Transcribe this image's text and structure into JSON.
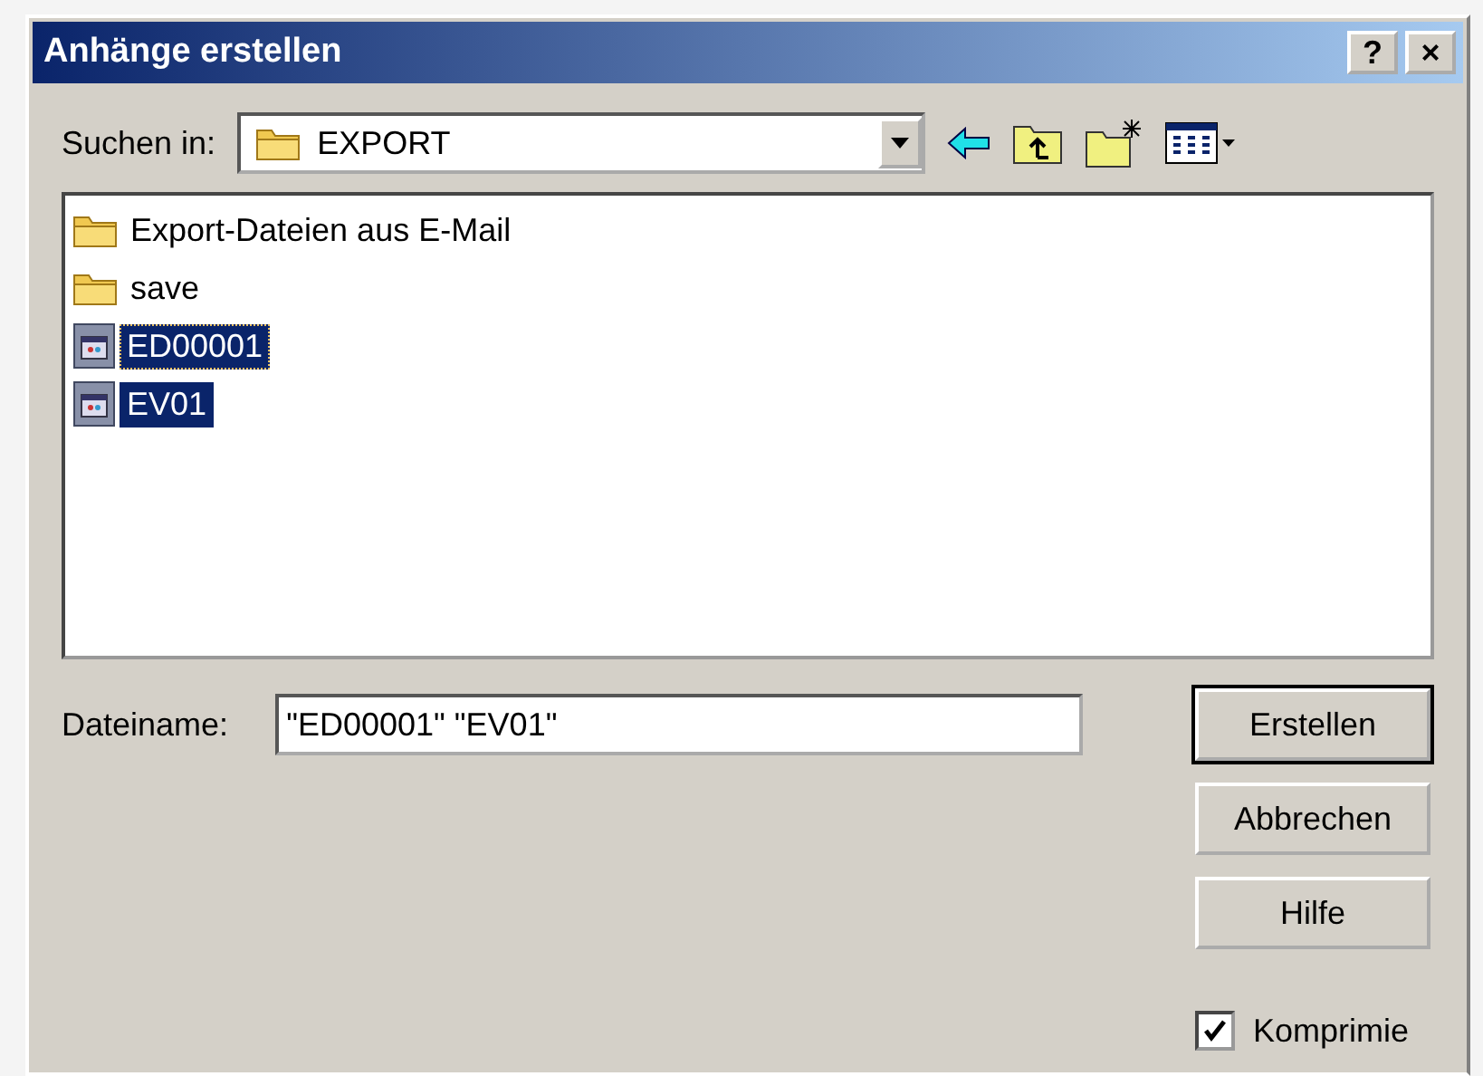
{
  "window": {
    "title": "Anhänge erstellen",
    "help_button": "?",
    "close_button": "×"
  },
  "look_in": {
    "label": "Suchen in:",
    "value": "EXPORT"
  },
  "files": [
    {
      "name": "Export-Dateien aus E-Mail",
      "kind": "folder",
      "selected": false,
      "focused": false
    },
    {
      "name": "save",
      "kind": "folder",
      "selected": false,
      "focused": false
    },
    {
      "name": "ED00001",
      "kind": "file",
      "selected": true,
      "focused": true
    },
    {
      "name": "EV01",
      "kind": "file",
      "selected": true,
      "focused": false
    }
  ],
  "filename": {
    "label": "Dateiname:",
    "value": "\"ED00001\" \"EV01\""
  },
  "buttons": [
    {
      "label": "Erstellen",
      "default": true
    },
    {
      "label": "Abbrechen",
      "default": false
    },
    {
      "label": "Hilfe",
      "default": false
    }
  ],
  "compress": {
    "label": "Komprimie",
    "checked": true
  }
}
